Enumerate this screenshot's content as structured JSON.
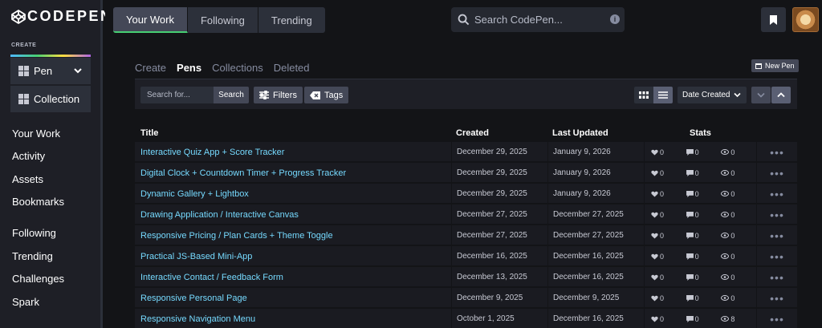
{
  "brand": {
    "name": "CODEPEN"
  },
  "sidebar": {
    "create_label": "CREATE",
    "pen_label": "Pen",
    "collection_label": "Collection",
    "nav_primary": [
      "Your Work",
      "Activity",
      "Assets",
      "Bookmarks"
    ],
    "nav_secondary": [
      "Following",
      "Trending",
      "Challenges",
      "Spark"
    ]
  },
  "topbar": {
    "tabs": [
      "Your Work",
      "Following",
      "Trending"
    ],
    "active_tab": "Your Work",
    "search_placeholder": "Search CodePen...",
    "info_glyph": "i"
  },
  "content": {
    "subtabs": [
      "Create",
      "Pens",
      "Collections",
      "Deleted"
    ],
    "active_subtab": "Pens",
    "new_pen_label": "New Pen",
    "toolbar": {
      "search_placeholder": "Search for...",
      "search_button": "Search",
      "filters_button": "Filters",
      "tags_button": "Tags",
      "sort_value": "Date Created"
    },
    "columns": {
      "title": "Title",
      "created": "Created",
      "updated": "Last Updated",
      "stats": "Stats"
    },
    "rows": [
      {
        "title": "Interactive Quiz App + Score Tracker",
        "created": "December 29, 2025",
        "updated": "January 9, 2026",
        "likes": "0",
        "comments": "0",
        "views": "0"
      },
      {
        "title": "Digital Clock + Countdown Timer + Progress Tracker",
        "created": "December 29, 2025",
        "updated": "January 9, 2026",
        "likes": "0",
        "comments": "0",
        "views": "0"
      },
      {
        "title": "Dynamic Gallery + Lightbox",
        "created": "December 29, 2025",
        "updated": "January 9, 2026",
        "likes": "0",
        "comments": "0",
        "views": "0"
      },
      {
        "title": "Drawing Application / Interactive Canvas",
        "created": "December 27, 2025",
        "updated": "December 27, 2025",
        "likes": "0",
        "comments": "0",
        "views": "0"
      },
      {
        "title": "Responsive Pricing / Plan Cards + Theme Toggle",
        "created": "December 27, 2025",
        "updated": "December 27, 2025",
        "likes": "0",
        "comments": "0",
        "views": "0"
      },
      {
        "title": "Practical JS-Based Mini-App",
        "created": "December 16, 2025",
        "updated": "December 16, 2025",
        "likes": "0",
        "comments": "0",
        "views": "0"
      },
      {
        "title": "Interactive Contact / Feedback Form",
        "created": "December 13, 2025",
        "updated": "December 16, 2025",
        "likes": "0",
        "comments": "0",
        "views": "0"
      },
      {
        "title": "Responsive Personal Page",
        "created": "December 9, 2025",
        "updated": "December 9, 2025",
        "likes": "0",
        "comments": "0",
        "views": "0"
      },
      {
        "title": "Responsive Navigation Menu",
        "created": "October 1, 2025",
        "updated": "December 16, 2025",
        "likes": "0",
        "comments": "0",
        "views": "8"
      }
    ],
    "more_glyph": "•••"
  },
  "colors": {
    "accent_green": "#47cf73",
    "link_blue": "#76daff",
    "panel": "#1e1f26"
  }
}
